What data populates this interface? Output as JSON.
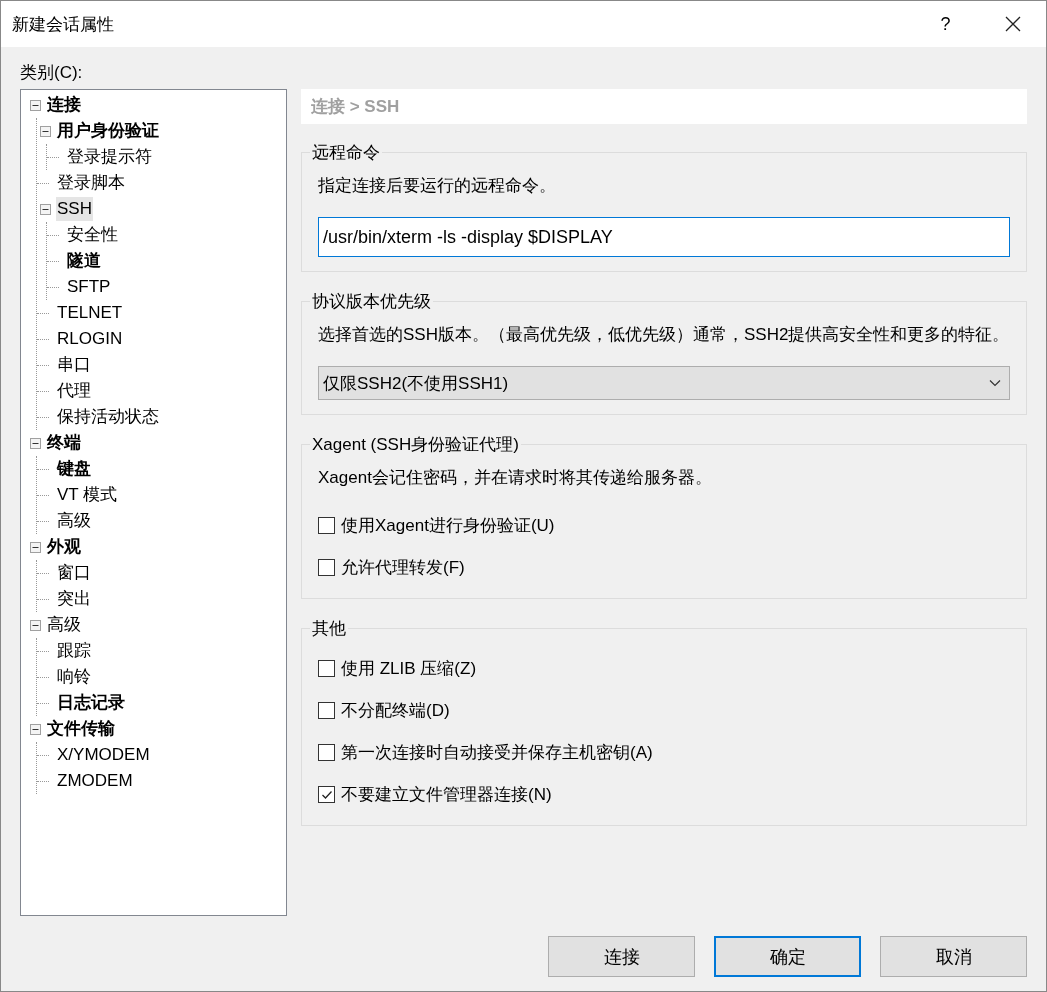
{
  "window": {
    "title": "新建会话属性",
    "help": "?"
  },
  "category_label": "类别(C):",
  "tree": [
    {
      "label": "连接",
      "bold": true,
      "selected": false,
      "expanded": true,
      "children": [
        {
          "label": "用户身份验证",
          "bold": true,
          "selected": false,
          "expanded": true,
          "children": [
            {
              "label": "登录提示符",
              "bold": false,
              "selected": false
            }
          ]
        },
        {
          "label": "登录脚本",
          "bold": false,
          "selected": false
        },
        {
          "label": "SSH",
          "bold": false,
          "selected": true,
          "expanded": true,
          "children": [
            {
              "label": "安全性",
              "bold": false,
              "selected": false
            },
            {
              "label": "隧道",
              "bold": true,
              "selected": false
            },
            {
              "label": "SFTP",
              "bold": false,
              "selected": false
            }
          ]
        },
        {
          "label": "TELNET",
          "bold": false,
          "selected": false
        },
        {
          "label": "RLOGIN",
          "bold": false,
          "selected": false
        },
        {
          "label": "串口",
          "bold": false,
          "selected": false
        },
        {
          "label": "代理",
          "bold": false,
          "selected": false
        },
        {
          "label": "保持活动状态",
          "bold": false,
          "selected": false
        }
      ]
    },
    {
      "label": "终端",
      "bold": true,
      "selected": false,
      "expanded": true,
      "children": [
        {
          "label": "键盘",
          "bold": true,
          "selected": false
        },
        {
          "label": "VT 模式",
          "bold": false,
          "selected": false
        },
        {
          "label": "高级",
          "bold": false,
          "selected": false
        }
      ]
    },
    {
      "label": "外观",
      "bold": true,
      "selected": false,
      "expanded": true,
      "children": [
        {
          "label": "窗口",
          "bold": false,
          "selected": false
        },
        {
          "label": "突出",
          "bold": false,
          "selected": false
        }
      ]
    },
    {
      "label": "高级",
      "bold": false,
      "selected": false,
      "expanded": true,
      "children": [
        {
          "label": "跟踪",
          "bold": false,
          "selected": false
        },
        {
          "label": "响铃",
          "bold": false,
          "selected": false
        },
        {
          "label": "日志记录",
          "bold": true,
          "selected": false
        }
      ]
    },
    {
      "label": "文件传输",
      "bold": true,
      "selected": false,
      "expanded": true,
      "children": [
        {
          "label": "X/YMODEM",
          "bold": false,
          "selected": false
        },
        {
          "label": "ZMODEM",
          "bold": false,
          "selected": false
        }
      ]
    }
  ],
  "breadcrumb": "连接 > SSH",
  "groups": [
    {
      "title": "远程命令",
      "description": "指定连接后要运行的远程命令。",
      "items": [
        {
          "kind": "input",
          "value": "/usr/bin/xterm -ls -display $DISPLAY"
        }
      ]
    },
    {
      "title": "协议版本优先级",
      "description": "选择首选的SSH版本。（最高优先级，低优先级）通常，SSH2提供高安全性和更多的特征。",
      "items": [
        {
          "kind": "select",
          "value": "仅限SSH2(不使用SSH1)"
        }
      ]
    },
    {
      "title": "Xagent (SSH身份验证代理)",
      "description": "Xagent会记住密码，并在请求时将其传递给服务器。",
      "items": [
        {
          "kind": "checkbox",
          "label": "使用Xagent进行身份验证(U)",
          "checked": false
        },
        {
          "kind": "checkbox",
          "label": "允许代理转发(F)",
          "checked": false
        }
      ]
    },
    {
      "title": "其他",
      "items": [
        {
          "kind": "checkbox",
          "label": "使用 ZLIB 压缩(Z)",
          "checked": false
        },
        {
          "kind": "checkbox",
          "label": "不分配终端(D)",
          "checked": false
        },
        {
          "kind": "checkbox",
          "label": "第一次连接时自动接受并保存主机密钥(A)",
          "checked": false
        },
        {
          "kind": "checkbox",
          "label": "不要建立文件管理器连接(N)",
          "checked": true
        }
      ]
    }
  ],
  "buttons": [
    {
      "label": "连接",
      "default": false
    },
    {
      "label": "确定",
      "default": true
    },
    {
      "label": "取消",
      "default": false
    }
  ]
}
